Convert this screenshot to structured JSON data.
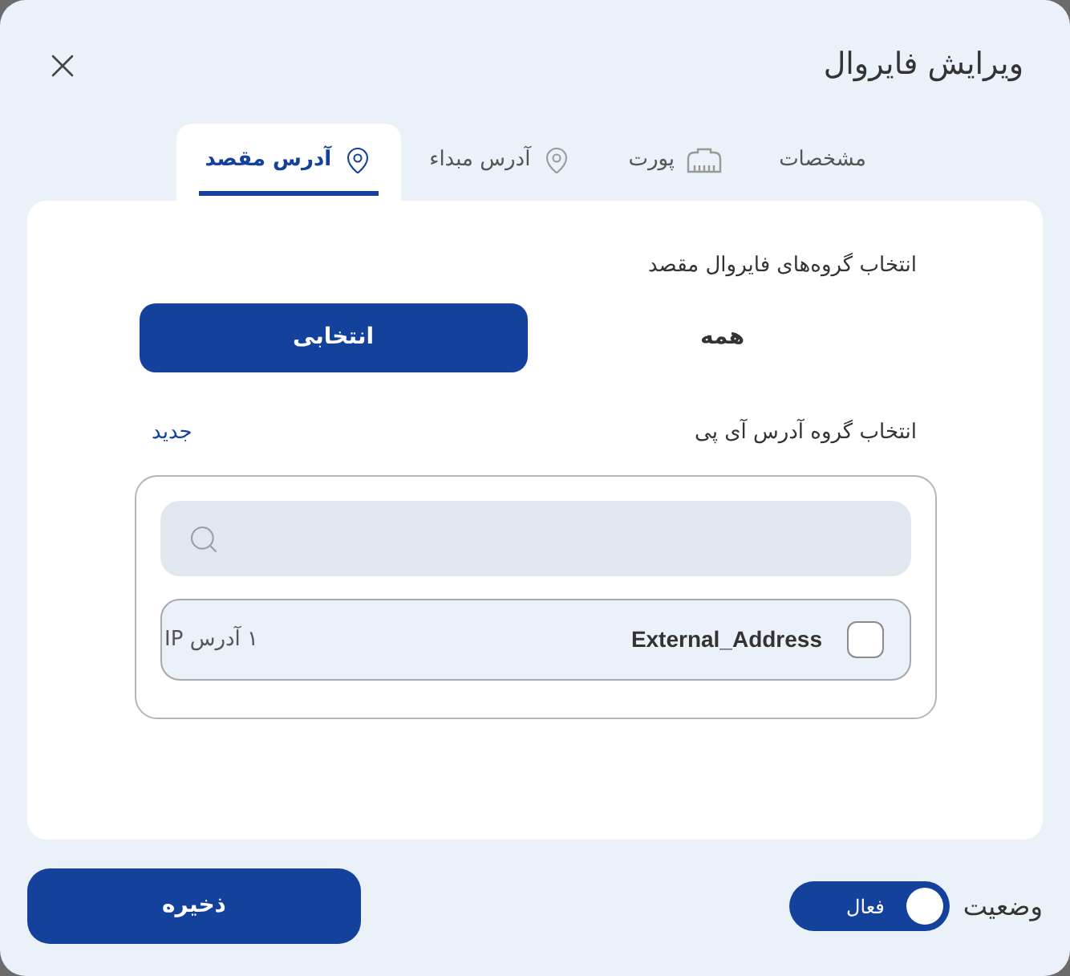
{
  "dialog": {
    "title": "ویرایش فایروال"
  },
  "tabs": [
    {
      "label": "مشخصات",
      "selected": false
    },
    {
      "label": "پورت",
      "selected": false
    },
    {
      "label": "آدرس مبداء",
      "selected": false
    },
    {
      "label": "آدرس مقصد",
      "selected": true
    }
  ],
  "firewall_groups": {
    "label": "انتخاب گروه‌های فایروال مقصد",
    "options": [
      {
        "label": "همه",
        "selected": false
      },
      {
        "label": "انتخابی",
        "selected": true
      }
    ]
  },
  "ip_groups": {
    "label": "انتخاب گروه آدرس آی پی",
    "new_link": "جدید",
    "items": [
      {
        "name": "External_Address",
        "count": "۱ آدرس IP",
        "checked": false
      }
    ]
  },
  "status": {
    "label": "وضعیت",
    "toggle": {
      "on": true,
      "label": "فعال"
    }
  },
  "save_button": "ذخیره"
}
